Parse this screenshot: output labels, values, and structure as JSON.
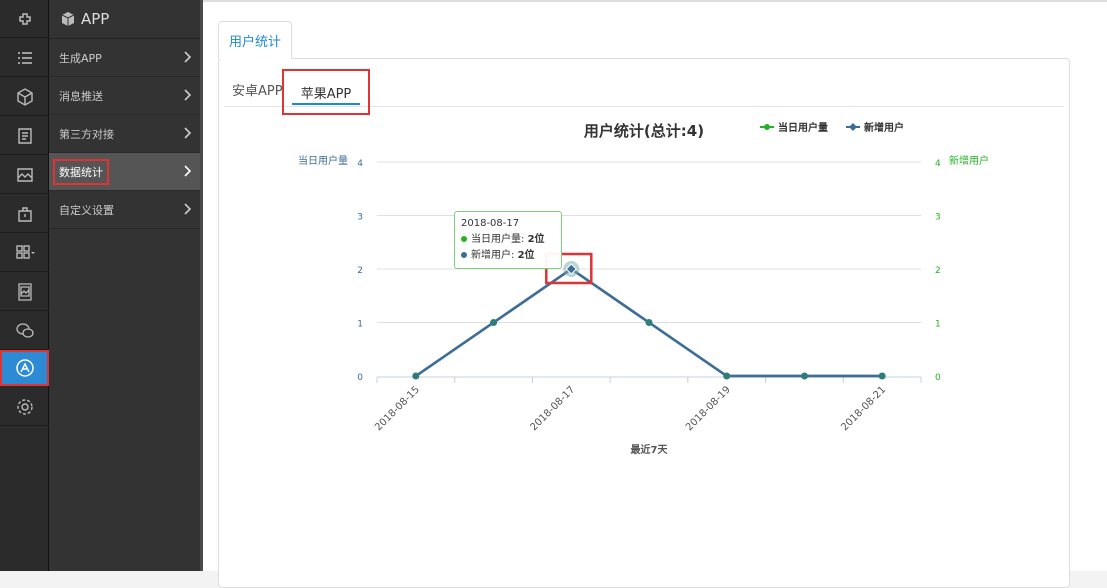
{
  "menu": {
    "header": "APP",
    "items": [
      {
        "label": "生成APP"
      },
      {
        "label": "消息推送"
      },
      {
        "label": "第三方对接"
      },
      {
        "label": "数据统计"
      },
      {
        "label": "自定义设置"
      }
    ]
  },
  "rail": {
    "icons": [
      "plugin-icon",
      "list-icon",
      "cube-icon",
      "document-icon",
      "image-icon",
      "bag-icon",
      "grid-icon",
      "picture-frame-icon",
      "wechat-icon",
      "app-store-icon",
      "gear-icon"
    ]
  },
  "tabs": {
    "main": "用户统计",
    "android": "安卓APP",
    "apple": "苹果APP"
  },
  "tooltip": {
    "date": "2018-08-17",
    "line1_label": "当日用户量:",
    "line1_value": "2位",
    "line2_label": "新增用户:",
    "line2_value": "2位"
  },
  "chart_data": {
    "type": "line",
    "title": "用户统计(总计:4)",
    "xlabel": "最近7天",
    "ylabel_left": "当日用户量",
    "ylabel_right": "新增用户",
    "ylim": [
      0,
      4
    ],
    "y_ticks": [
      0,
      1,
      2,
      3,
      4
    ],
    "x": [
      "2018-08-15",
      "2018-08-16",
      "2018-08-17",
      "2018-08-18",
      "2018-08-19",
      "2018-08-20",
      "2018-08-21"
    ],
    "x_tick_labels": [
      "2018-08-15",
      "2018-08-17",
      "2018-08-19",
      "2018-08-21"
    ],
    "series": [
      {
        "name": "当日用户量",
        "values": [
          0,
          1,
          2,
          1,
          0,
          0,
          0
        ],
        "color": "#24b324"
      },
      {
        "name": "新增用户",
        "values": [
          0,
          1,
          2,
          1,
          0,
          0,
          0
        ],
        "color": "#3e6d98"
      }
    ],
    "legend": "top-right",
    "grid": true
  }
}
